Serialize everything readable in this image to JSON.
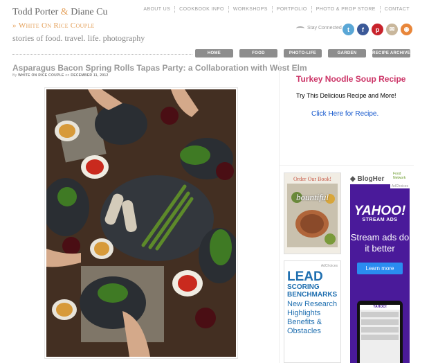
{
  "brand": {
    "name_left": "Todd Porter",
    "amp": "&",
    "name_right": "Diane Cu",
    "site_name": "White On Rice Couple",
    "motto": "stories of food. travel. life. photography"
  },
  "top_nav": [
    "ABOUT US",
    "COOKBOOK INFO",
    "WORKSHOPS",
    "PORTFOLIO",
    "PHOTO & PROP STORE",
    "CONTACT"
  ],
  "stay_connected": "Stay Connected",
  "social": [
    {
      "icon": "twitter-icon",
      "glyph": "t",
      "color": "#5aa7d6"
    },
    {
      "icon": "facebook-icon",
      "glyph": "f",
      "color": "#3b5998"
    },
    {
      "icon": "pinterest-icon",
      "glyph": "p",
      "color": "#c8232c"
    },
    {
      "icon": "email-icon",
      "glyph": "✉",
      "color": "#c9b79c"
    },
    {
      "icon": "rss-icon",
      "glyph": "◉",
      "color": "#e8863a"
    }
  ],
  "main_nav": [
    "HOME",
    "FOOD",
    "PHOTO-LIFE",
    "GARDEN",
    "RECIPE ARCHIVE"
  ],
  "post": {
    "title": "Asparagus Bacon Spring Rolls Tapas Party: a Collaboration with West Elm",
    "by": "By",
    "author": "WHITE ON RICE COUPLE",
    "on": "on",
    "date": "DECEMBER 11, 2012"
  },
  "promo": {
    "title": "Turkey Noodle Soup Recipe",
    "body": "Try This Delicious Recipe and More!",
    "link": "Click Here for Recipe."
  },
  "ads": {
    "book_header": "Order Our Book!",
    "book_title": "bountiful",
    "lead_choices": "AdChoices",
    "lead_big": "LEAD",
    "lead_mid1": "SCORING",
    "lead_mid2": "BENCHMARKS",
    "lead_sub": "New Research Highlights Benefits & Obstacles",
    "blogher": "BlogHer",
    "blogher_sub": "Food Network",
    "yahoo_choices": "AdChoices",
    "yahoo_logo": "YAHOO!",
    "yahoo_sub": "STREAM ADS",
    "yahoo_msg": "Stream ads do it better",
    "yahoo_btn": "Learn more",
    "yahoo_phone": "YAHOO!"
  }
}
